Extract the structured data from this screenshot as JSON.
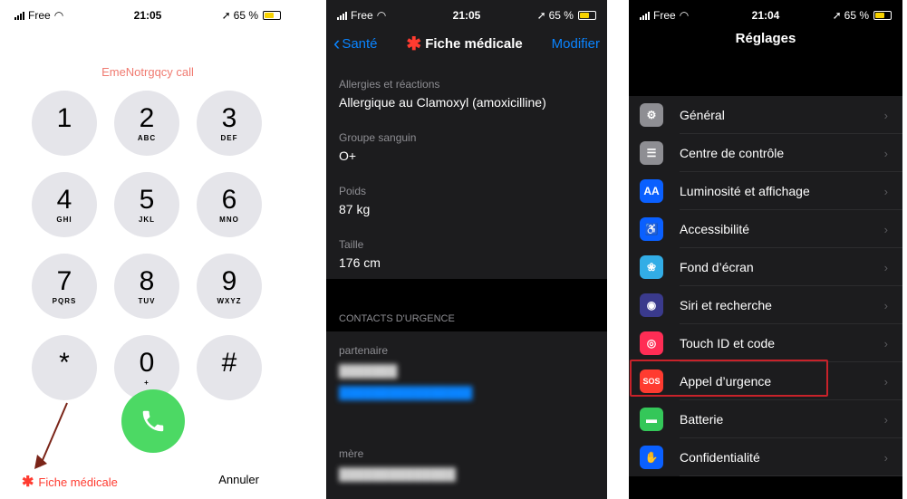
{
  "colors": {
    "emergency_red": "#ff3b30",
    "call_green": "#4cd964",
    "ios_blue": "#0a84ff",
    "highlight_red": "#c8222a"
  },
  "dialer": {
    "status": {
      "carrier": "Free",
      "time": "21:05",
      "battery": "65 %"
    },
    "emergency_label": "EmeNotrgqcy call",
    "keys": [
      {
        "digit": "1",
        "letters": ""
      },
      {
        "digit": "2",
        "letters": "ABC"
      },
      {
        "digit": "3",
        "letters": "DEF"
      },
      {
        "digit": "4",
        "letters": "GHI"
      },
      {
        "digit": "5",
        "letters": "JKL"
      },
      {
        "digit": "6",
        "letters": "MNO"
      },
      {
        "digit": "7",
        "letters": "PQRS"
      },
      {
        "digit": "8",
        "letters": "TUV"
      },
      {
        "digit": "9",
        "letters": "WXYZ"
      },
      {
        "digit": "*",
        "letters": ""
      },
      {
        "digit": "0",
        "letters": "+"
      },
      {
        "digit": "#",
        "letters": ""
      }
    ],
    "fiche_label": "Fiche médicale",
    "cancel_label": "Annuler"
  },
  "medical": {
    "status": {
      "carrier": "Free",
      "time": "21:05",
      "battery": "65 %"
    },
    "back_label": "Santé",
    "title": "Fiche médicale",
    "edit_label": "Modifier",
    "fields": [
      {
        "label": "Allergies et réactions",
        "value": "Allergique au Clamoxyl (amoxicilline)"
      },
      {
        "label": "Groupe sanguin",
        "value": "O+"
      },
      {
        "label": "Poids",
        "value": "87 kg"
      },
      {
        "label": "Taille",
        "value": "176 cm"
      }
    ],
    "contacts_header": "CONTACTS D'URGENCE",
    "contacts": [
      {
        "relation": "partenaire"
      },
      {
        "relation": "mère"
      }
    ]
  },
  "settings": {
    "status": {
      "carrier": "Free",
      "time": "21:04",
      "battery": "65 %"
    },
    "title": "Réglages",
    "items": [
      {
        "label": "Général",
        "icon": "gear-icon",
        "color": "#8e8e93",
        "glyph": "⚙"
      },
      {
        "label": "Centre de contrôle",
        "icon": "control-center-icon",
        "color": "#8e8e93",
        "glyph": "☰"
      },
      {
        "label": "Luminosité et affichage",
        "icon": "display-icon",
        "color": "#0a60ff",
        "glyph": "AA"
      },
      {
        "label": "Accessibilité",
        "icon": "accessibility-icon",
        "color": "#0a60ff",
        "glyph": "♿"
      },
      {
        "label": "Fond d’écran",
        "icon": "wallpaper-icon",
        "color": "#32ade6",
        "glyph": "❀"
      },
      {
        "label": "Siri et recherche",
        "icon": "siri-icon",
        "color": "#3a3a8c",
        "glyph": "◉"
      },
      {
        "label": "Touch ID et code",
        "icon": "fingerprint-icon",
        "color": "#ff2d55",
        "glyph": "◎"
      },
      {
        "label": "Appel d’urgence",
        "icon": "sos-icon",
        "color": "#ff3b30",
        "glyph": "SOS"
      },
      {
        "label": "Batterie",
        "icon": "battery-icon",
        "color": "#34c759",
        "glyph": "▬"
      },
      {
        "label": "Confidentialité",
        "icon": "hand-icon",
        "color": "#0a60ff",
        "glyph": "✋"
      }
    ]
  }
}
